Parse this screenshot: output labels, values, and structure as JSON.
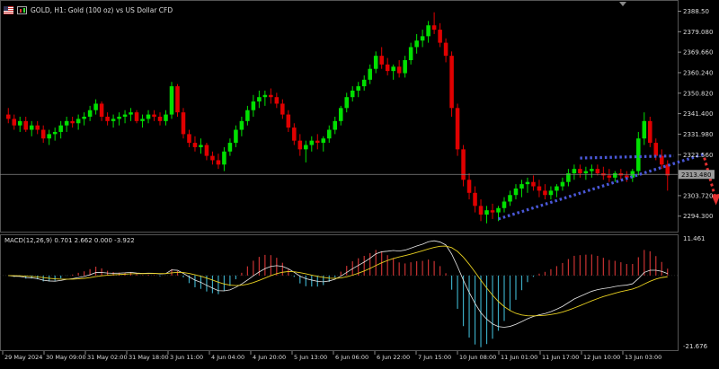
{
  "header": {
    "title": "GOLD, H1:  Gold (100 oz) vs US Dollar CFD"
  },
  "macd": {
    "label": "MACD(12,26,9) 0.701 2.662 0.000 -3.922",
    "scale_top": "11.461",
    "scale_bottom": "-21.676"
  },
  "price_axis": {
    "labels": [
      "2388.50",
      "2379.080",
      "2369.660",
      "2360.240",
      "2350.820",
      "2341.400",
      "2331.980",
      "2322.560",
      "2303.720",
      "2294.300"
    ],
    "current_price": "2313.480"
  },
  "time_axis": {
    "labels": [
      "29 May 2024",
      "30 May 09:00",
      "31 May 02:00",
      "31 May 18:00",
      "3 Jun 11:00",
      "4 Jun 04:00",
      "4 Jun 20:00",
      "5 Jun 13:00",
      "6 Jun 06:00",
      "6 Jun 22:00",
      "7 Jun 15:00",
      "10 Jun 08:00",
      "11 Jun 01:00",
      "11 Jun 17:00",
      "12 Jun 10:00",
      "13 Jun 03:00"
    ]
  },
  "colors": {
    "background": "#000000",
    "bull": "#00e000",
    "bear": "#e00000",
    "macd_pos": "#c83232",
    "macd_neg": "#3aa8c0",
    "signal": "#e8d020",
    "macd_line": "#e8e8e8",
    "trendline": "#4a58d8",
    "arrow": "#e23030",
    "grid": "#555555",
    "text": "#dddddd"
  },
  "chart_data": {
    "type": "candlestick",
    "symbol": "GOLD",
    "timeframe": "H1",
    "ylim": [
      2288,
      2392
    ],
    "candles": [
      [
        2341,
        2344,
        2337,
        2339
      ],
      [
        2339,
        2341,
        2334,
        2336
      ],
      [
        2336,
        2340,
        2333,
        2338
      ],
      [
        2338,
        2340,
        2333,
        2334
      ],
      [
        2334,
        2338,
        2331,
        2336
      ],
      [
        2336,
        2338,
        2332,
        2334
      ],
      [
        2334,
        2336,
        2328,
        2330
      ],
      [
        2330,
        2334,
        2327,
        2332
      ],
      [
        2332,
        2335,
        2329,
        2333
      ],
      [
        2333,
        2338,
        2330,
        2336
      ],
      [
        2336,
        2340,
        2333,
        2338
      ],
      [
        2338,
        2340,
        2335,
        2337
      ],
      [
        2337,
        2341,
        2334,
        2339
      ],
      [
        2339,
        2342,
        2336,
        2340
      ],
      [
        2340,
        2345,
        2338,
        2343
      ],
      [
        2343,
        2348,
        2341,
        2346
      ],
      [
        2346,
        2347,
        2338,
        2340
      ],
      [
        2340,
        2342,
        2336,
        2338
      ],
      [
        2338,
        2341,
        2335,
        2339
      ],
      [
        2339,
        2342,
        2336,
        2340
      ],
      [
        2340,
        2343,
        2337,
        2341
      ],
      [
        2341,
        2344,
        2338,
        2342
      ],
      [
        2342,
        2343,
        2337,
        2338
      ],
      [
        2338,
        2341,
        2335,
        2339
      ],
      [
        2339,
        2343,
        2337,
        2341
      ],
      [
        2341,
        2343,
        2338,
        2340
      ],
      [
        2340,
        2342,
        2336,
        2338
      ],
      [
        2338,
        2343,
        2336,
        2341
      ],
      [
        2341,
        2356,
        2339,
        2354
      ],
      [
        2354,
        2355,
        2340,
        2342
      ],
      [
        2342,
        2344,
        2330,
        2332
      ],
      [
        2332,
        2334,
        2326,
        2328
      ],
      [
        2328,
        2331,
        2324,
        2326
      ],
      [
        2326,
        2330,
        2323,
        2327
      ],
      [
        2327,
        2328,
        2320,
        2322
      ],
      [
        2322,
        2324,
        2318,
        2320
      ],
      [
        2320,
        2323,
        2316,
        2318
      ],
      [
        2318,
        2326,
        2315,
        2324
      ],
      [
        2324,
        2330,
        2322,
        2328
      ],
      [
        2328,
        2336,
        2326,
        2334
      ],
      [
        2334,
        2340,
        2331,
        2338
      ],
      [
        2338,
        2345,
        2336,
        2343
      ],
      [
        2343,
        2350,
        2340,
        2347
      ],
      [
        2347,
        2352,
        2344,
        2349
      ],
      [
        2349,
        2352,
        2345,
        2350
      ],
      [
        2350,
        2353,
        2346,
        2349
      ],
      [
        2349,
        2351,
        2344,
        2346
      ],
      [
        2346,
        2348,
        2339,
        2341
      ],
      [
        2341,
        2343,
        2333,
        2335
      ],
      [
        2335,
        2337,
        2327,
        2329
      ],
      [
        2329,
        2332,
        2322,
        2325
      ],
      [
        2325,
        2329,
        2319,
        2327
      ],
      [
        2327,
        2331,
        2324,
        2329
      ],
      [
        2329,
        2332,
        2325,
        2328
      ],
      [
        2328,
        2331,
        2324,
        2330
      ],
      [
        2330,
        2336,
        2328,
        2334
      ],
      [
        2334,
        2340,
        2332,
        2338
      ],
      [
        2338,
        2345,
        2336,
        2344
      ],
      [
        2344,
        2351,
        2342,
        2349
      ],
      [
        2349,
        2354,
        2347,
        2352
      ],
      [
        2352,
        2356,
        2349,
        2354
      ],
      [
        2354,
        2359,
        2352,
        2357
      ],
      [
        2357,
        2364,
        2355,
        2362
      ],
      [
        2362,
        2370,
        2360,
        2368
      ],
      [
        2368,
        2372,
        2362,
        2364
      ],
      [
        2364,
        2367,
        2359,
        2361
      ],
      [
        2361,
        2364,
        2357,
        2363
      ],
      [
        2363,
        2366,
        2358,
        2360
      ],
      [
        2360,
        2368,
        2358,
        2366
      ],
      [
        2366,
        2374,
        2364,
        2372
      ],
      [
        2372,
        2378,
        2369,
        2375
      ],
      [
        2375,
        2380,
        2372,
        2377
      ],
      [
        2377,
        2384,
        2374,
        2382
      ],
      [
        2382,
        2388,
        2378,
        2380
      ],
      [
        2380,
        2383,
        2372,
        2374
      ],
      [
        2374,
        2376,
        2365,
        2368
      ],
      [
        2368,
        2370,
        2340,
        2344
      ],
      [
        2344,
        2346,
        2322,
        2325
      ],
      [
        2325,
        2327,
        2308,
        2311
      ],
      [
        2311,
        2314,
        2302,
        2305
      ],
      [
        2305,
        2308,
        2296,
        2299
      ],
      [
        2299,
        2302,
        2292,
        2295
      ],
      [
        2295,
        2299,
        2291,
        2297
      ],
      [
        2297,
        2300,
        2293,
        2296
      ],
      [
        2296,
        2299,
        2292,
        2298
      ],
      [
        2298,
        2303,
        2296,
        2301
      ],
      [
        2301,
        2306,
        2299,
        2304
      ],
      [
        2304,
        2309,
        2302,
        2307
      ],
      [
        2307,
        2311,
        2303,
        2309
      ],
      [
        2309,
        2312,
        2305,
        2310
      ],
      [
        2310,
        2313,
        2306,
        2308
      ],
      [
        2308,
        2311,
        2303,
        2306
      ],
      [
        2306,
        2309,
        2302,
        2304
      ],
      [
        2304,
        2308,
        2302,
        2306
      ],
      [
        2306,
        2309,
        2303,
        2308
      ],
      [
        2308,
        2312,
        2306,
        2310
      ],
      [
        2310,
        2316,
        2308,
        2314
      ],
      [
        2314,
        2318,
        2311,
        2316
      ],
      [
        2316,
        2318,
        2312,
        2314
      ],
      [
        2314,
        2317,
        2311,
        2315
      ],
      [
        2315,
        2318,
        2312,
        2316
      ],
      [
        2316,
        2318,
        2313,
        2314
      ],
      [
        2314,
        2317,
        2311,
        2313
      ],
      [
        2313,
        2316,
        2310,
        2312
      ],
      [
        2312,
        2315,
        2310,
        2314
      ],
      [
        2314,
        2316,
        2311,
        2313
      ],
      [
        2313,
        2315,
        2310,
        2312
      ],
      [
        2312,
        2316,
        2310,
        2315
      ],
      [
        2315,
        2333,
        2313,
        2330
      ],
      [
        2330,
        2342,
        2327,
        2338
      ],
      [
        2338,
        2340,
        2326,
        2328
      ],
      [
        2328,
        2330,
        2320,
        2322
      ],
      [
        2322,
        2325,
        2316,
        2318
      ],
      [
        2318,
        2320,
        2306,
        2313
      ]
    ],
    "trendlines": {
      "rising_support": {
        "from": [
          84,
          2293
        ],
        "to": [
          118,
          2322
        ]
      },
      "horizontal_resistance": {
        "from": [
          98,
          2321
        ],
        "to": [
          119,
          2322
        ]
      },
      "projection": "down"
    },
    "macd": {
      "params": "12,26,9",
      "values": [
        0.701,
        2.662,
        0.0,
        -3.922
      ],
      "ylim": [
        -21.676,
        11.461
      ]
    }
  }
}
